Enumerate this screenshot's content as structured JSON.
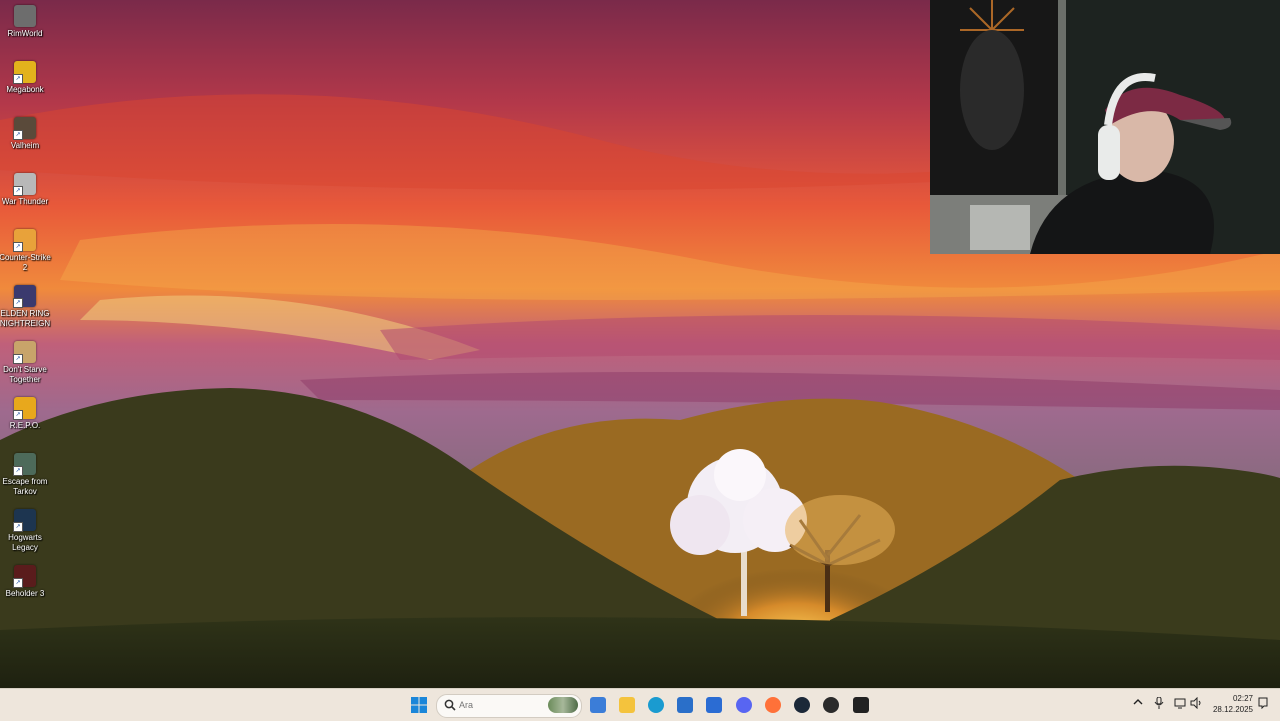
{
  "desktop": {
    "icons": [
      {
        "label": "RimWorld",
        "icon": "rimworld-icon",
        "color": "#6d6d6d"
      },
      {
        "label": "Megabonk",
        "icon": "megabonk-icon",
        "color": "#e2b21c"
      },
      {
        "label": "Valheim",
        "icon": "valheim-icon",
        "color": "#5a4a3a"
      },
      {
        "label": "War Thunder",
        "icon": "war-thunder-icon",
        "color": "#b8b8b8"
      },
      {
        "label": "Counter-Strike 2",
        "icon": "counter-strike-icon",
        "color": "#e8a23a"
      },
      {
        "label": "ELDEN RING NIGHTREIGN",
        "icon": "elden-ring-icon",
        "color": "#3b3a6e"
      },
      {
        "label": "Don't Starve Together",
        "icon": "dont-starve-icon",
        "color": "#c8a46a"
      },
      {
        "label": "R.E.P.O.",
        "icon": "repo-icon",
        "color": "#e8a81c"
      },
      {
        "label": "Escape from Tarkov",
        "icon": "tarkov-icon",
        "color": "#4d6a5a"
      },
      {
        "label": "Hogwarts Legacy",
        "icon": "hogwarts-icon",
        "color": "#1d3550"
      },
      {
        "label": "Beholder 3",
        "icon": "beholder-icon",
        "color": "#5a1c1c"
      }
    ]
  },
  "taskbar": {
    "search_placeholder": "Ara",
    "apps": [
      {
        "name": "start-button",
        "icon": "windows-icon",
        "color": "#1a86d9"
      },
      {
        "name": "widgets-button",
        "icon": "widgets-icon",
        "color": "#3b7dd8"
      },
      {
        "name": "file-explorer-button",
        "icon": "folder-icon",
        "color": "#f4c33d"
      },
      {
        "name": "edge-button",
        "icon": "edge-icon",
        "color": "#1a9bd0"
      },
      {
        "name": "store-button",
        "icon": "store-icon",
        "color": "#2a6fc9"
      },
      {
        "name": "outlook-button",
        "icon": "outlook-icon",
        "color": "#2b6cd3"
      },
      {
        "name": "discord-button",
        "icon": "discord-icon",
        "color": "#5865f2"
      },
      {
        "name": "firefox-button",
        "icon": "firefox-icon",
        "color": "#ff7139"
      },
      {
        "name": "steam-button",
        "icon": "steam-icon",
        "color": "#1b2838"
      },
      {
        "name": "obs-button",
        "icon": "obs-icon",
        "color": "#2b2b2b"
      },
      {
        "name": "epic-games-button",
        "icon": "epic-games-icon",
        "color": "#222222"
      }
    ],
    "tray": {
      "time": "02:27",
      "date": "28.12.2025"
    }
  }
}
